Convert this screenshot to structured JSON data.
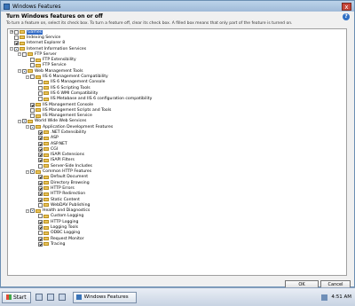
{
  "window": {
    "title": "Windows Features",
    "close_glyph": "x",
    "heading": "Turn Windows features on or off",
    "instruction": "To turn a feature on, select its check box. To turn a feature off, clear its check box. A filled box means that only part of the feature is turned on.",
    "help_glyph": "?"
  },
  "tree": [
    {
      "label": "Games",
      "level": 0,
      "expander": "+",
      "check": "none",
      "selected": true
    },
    {
      "label": "Indexing Service",
      "level": 0,
      "expander": "",
      "check": "none"
    },
    {
      "label": "Internet Explorer 8",
      "level": 0,
      "expander": "",
      "check": "checked"
    },
    {
      "label": "Internet Information Services",
      "level": 0,
      "expander": "-",
      "check": "partial"
    },
    {
      "label": "FTP Server",
      "level": 1,
      "expander": "-",
      "check": "none"
    },
    {
      "label": "FTP Extensibility",
      "level": 2,
      "expander": "",
      "check": "none"
    },
    {
      "label": "FTP Service",
      "level": 2,
      "expander": "",
      "check": "none"
    },
    {
      "label": "Web Management Tools",
      "level": 1,
      "expander": "-",
      "check": "partial"
    },
    {
      "label": "IIS 6 Management Compatibility",
      "level": 2,
      "expander": "-",
      "check": "none"
    },
    {
      "label": "IIS 6 Management Console",
      "level": 3,
      "expander": "",
      "check": "none"
    },
    {
      "label": "IIS 6 Scripting Tools",
      "level": 3,
      "expander": "",
      "check": "none"
    },
    {
      "label": "IIS 6 WMI Compatibility",
      "level": 3,
      "expander": "",
      "check": "none"
    },
    {
      "label": "IIS Metabase and IIS 6 configuration compatibility",
      "level": 3,
      "expander": "",
      "check": "none"
    },
    {
      "label": "IIS Management Console",
      "level": 2,
      "expander": "",
      "check": "checked"
    },
    {
      "label": "IIS Management Scripts and Tools",
      "level": 2,
      "expander": "",
      "check": "none"
    },
    {
      "label": "IIS Management Service",
      "level": 2,
      "expander": "",
      "check": "none"
    },
    {
      "label": "World Wide Web Services",
      "level": 1,
      "expander": "-",
      "check": "partial"
    },
    {
      "label": "Application Development Features",
      "level": 2,
      "expander": "-",
      "check": "partial"
    },
    {
      "label": ".NET Extensibility",
      "level": 3,
      "expander": "",
      "check": "checked"
    },
    {
      "label": "ASP",
      "level": 3,
      "expander": "",
      "check": "checked"
    },
    {
      "label": "ASP.NET",
      "level": 3,
      "expander": "",
      "check": "checked"
    },
    {
      "label": "CGI",
      "level": 3,
      "expander": "",
      "check": "checked"
    },
    {
      "label": "ISAPI Extensions",
      "level": 3,
      "expander": "",
      "check": "checked"
    },
    {
      "label": "ISAPI Filters",
      "level": 3,
      "expander": "",
      "check": "checked"
    },
    {
      "label": "Server-Side Includes",
      "level": 3,
      "expander": "",
      "check": "none"
    },
    {
      "label": "Common HTTP Features",
      "level": 2,
      "expander": "-",
      "check": "partial"
    },
    {
      "label": "Default Document",
      "level": 3,
      "expander": "",
      "check": "checked"
    },
    {
      "label": "Directory Browsing",
      "level": 3,
      "expander": "",
      "check": "checked"
    },
    {
      "label": "HTTP Errors",
      "level": 3,
      "expander": "",
      "check": "checked"
    },
    {
      "label": "HTTP Redirection",
      "level": 3,
      "expander": "",
      "check": "checked"
    },
    {
      "label": "Static Content",
      "level": 3,
      "expander": "",
      "check": "checked"
    },
    {
      "label": "WebDAV Publishing",
      "level": 3,
      "expander": "",
      "check": "none"
    },
    {
      "label": "Health and Diagnostics",
      "level": 2,
      "expander": "-",
      "check": "partial"
    },
    {
      "label": "Custom Logging",
      "level": 3,
      "expander": "",
      "check": "none"
    },
    {
      "label": "HTTP Logging",
      "level": 3,
      "expander": "",
      "check": "checked"
    },
    {
      "label": "Logging Tools",
      "level": 3,
      "expander": "",
      "check": "checked"
    },
    {
      "label": "ODBC Logging",
      "level": 3,
      "expander": "",
      "check": "none"
    },
    {
      "label": "Request Monitor",
      "level": 3,
      "expander": "",
      "check": "checked"
    },
    {
      "label": "Tracing",
      "level": 3,
      "expander": "",
      "check": "checked"
    }
  ],
  "buttons": {
    "ok": "OK",
    "cancel": "Cancel"
  },
  "taskbar": {
    "start": "Start",
    "task": "Windows Features",
    "clock": "4:51 AM"
  },
  "colors": {
    "selection": "#316ac5",
    "title_bar": "#bcd3ea"
  }
}
